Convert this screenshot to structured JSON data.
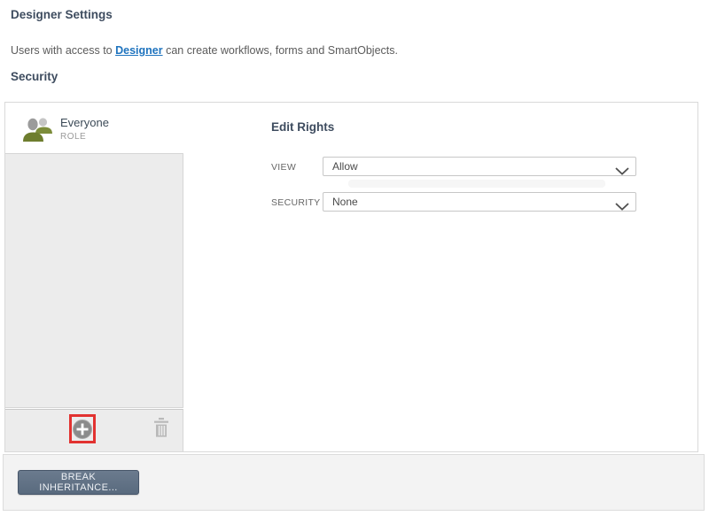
{
  "header": {
    "title": "Designer Settings",
    "description": {
      "prefix": "Users with access to ",
      "link": "Designer",
      "suffix": " can create workflows, forms and SmartObjects."
    },
    "section_title": "Security"
  },
  "security_panel": {
    "role": {
      "name": "Everyone",
      "type": "ROLE"
    },
    "edit_rights": {
      "title": "Edit Rights",
      "fields": [
        {
          "label": "VIEW",
          "value": "Allow"
        },
        {
          "label": "SECURITY",
          "value": "None"
        }
      ]
    },
    "toolbar": {
      "icons": [
        "plus-icon",
        "trash-icon"
      ],
      "add_highlighted": true
    }
  },
  "footer": {
    "break_inheritance_label": "BREAK INHERITANCE..."
  },
  "colors": {
    "heading": "#3e4c5f",
    "link": "#1e73be",
    "highlight_red": "#e23230",
    "icon_olive_front": "#6e7d2e",
    "icon_olive_back": "#7c8c3a",
    "button_slate": "#5f7085",
    "list_gray": "#ececec"
  }
}
